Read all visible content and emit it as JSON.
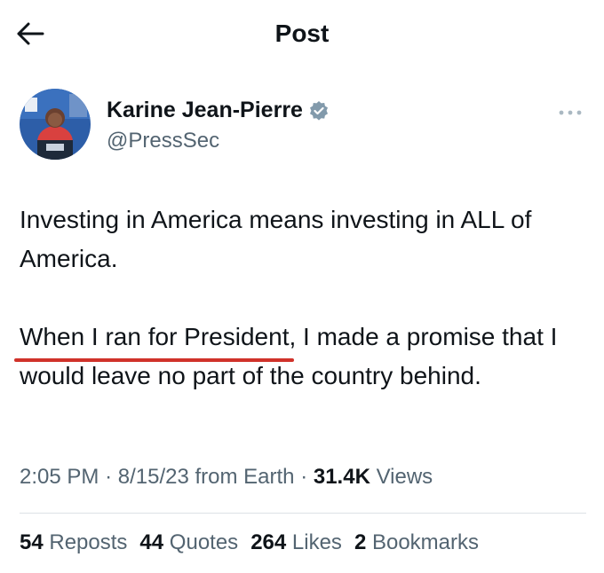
{
  "header": {
    "title": "Post",
    "back_icon": "arrow-left-icon"
  },
  "author": {
    "display_name": "Karine Jean-Pierre",
    "handle": "@PressSec",
    "verified_icon": "verified-badge-icon",
    "more_icon": "more-options-icon",
    "badge_color": "#829aab"
  },
  "tweet": {
    "paragraph1": "Investing in America means investing in ALL of America.",
    "paragraph2_underlined": "When I ran for President",
    "paragraph2_rest": ", I made a promise that I would leave no part of the country behind.",
    "annotation_color": "#d0322a"
  },
  "meta": {
    "time": "2:05 PM",
    "sep1": "·",
    "date": "8/15/23",
    "source": "from Earth",
    "sep2": "·",
    "views_count": "31.4K",
    "views_label": "Views"
  },
  "stats": {
    "reposts_count": "54",
    "reposts_label": "Reposts",
    "quotes_count": "44",
    "quotes_label": "Quotes",
    "likes_count": "264",
    "likes_label": "Likes",
    "bookmarks_count": "2",
    "bookmarks_label": "Bookmarks"
  }
}
